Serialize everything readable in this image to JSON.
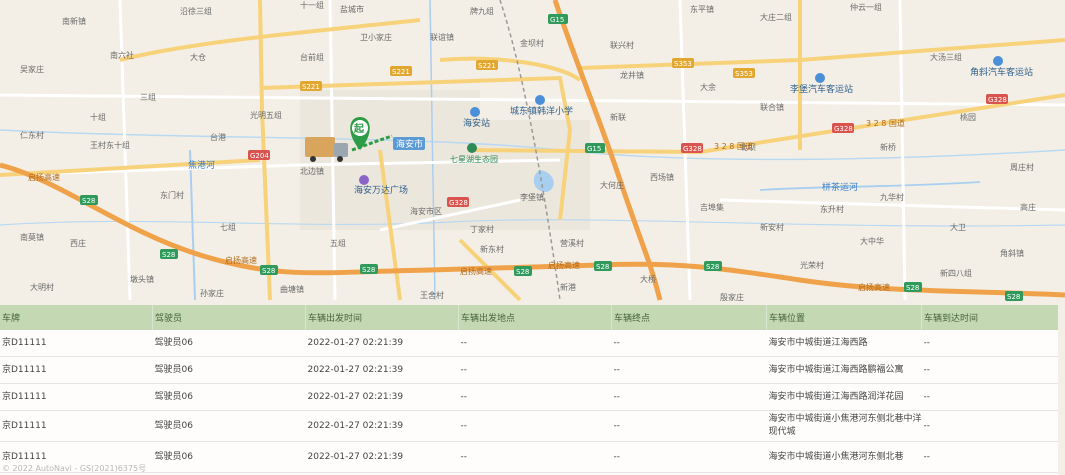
{
  "map": {
    "districts": {
      "haian_city": "海安市",
      "haian_wanda": "海安万达广场",
      "chengdong_school": "城东镇韩洋小学",
      "qixing_park": "七星湖生态园",
      "haian_station": "海安站",
      "lipu_bus": "李堡汽车客运站",
      "jiaoxie_bus": "角斜汽车客运站",
      "rangtong_canal": "栟茶运河",
      "jiaogang_river": "焦港河",
      "start_label": "起"
    },
    "road_labels": {
      "g15_top": "G15",
      "g15_mid": "G15",
      "s221_a": "S221",
      "s221_b": "S221",
      "s221_c": "S221",
      "s353": "S353",
      "s353_b": "S353",
      "g204": "G204",
      "g328_a": "G328",
      "g328_b": "G328",
      "g328_c": "G328",
      "g328_d": "G328",
      "s28_a": "S28",
      "s28_b": "S28",
      "s28_c": "S28",
      "s28_d": "S28",
      "s28_e": "S28",
      "s28_f": "S28",
      "s28_g": "S28",
      "s28_h": "S28",
      "s28_i": "S28",
      "guodao_328": "3 2 8 国道",
      "guodao_328b": "3 2 8 国道",
      "ningyang_a": "启扬高速",
      "ningyang_b": "启扬高速",
      "ningyang_c": "启扬高速",
      "ningyang_d": "启扬高速",
      "ningyang_e": "启扬高速"
    },
    "place_labels": [
      "南新镇",
      "沿徐三组",
      "十一组",
      "盐城市",
      "牌九组",
      "金坝村",
      "联兴村",
      "东平镇",
      "大庄二组",
      "仲云一组",
      "吴家庄",
      "南六社",
      "大仓",
      "台前组",
      "卫小家庄",
      "联谊镇",
      "龙井镇",
      "大余",
      "联合镇",
      "大汤三组",
      "仁东村",
      "王村东十组",
      "东门村",
      "台港",
      "光明五组",
      "北边镇",
      "海安市区",
      "丁家村",
      "李堡镇",
      "大何庄",
      "西场镇",
      "吉埠集",
      "新安村",
      "东升村",
      "九华村",
      "大卫",
      "周庄村",
      "南莫镇",
      "西庄",
      "墩头镇",
      "孙家庄",
      "曲塘镇",
      "王舍村",
      "新东村",
      "营溪村",
      "大桥",
      "殷家庄",
      "光荣村",
      "大中华",
      "新四八组",
      "角斜镇",
      "大明村",
      "十组",
      "三组",
      "七组",
      "五组",
      "新港",
      "新联",
      "北坝",
      "新桥",
      "桃园",
      "高庄"
    ]
  },
  "table": {
    "headers": [
      "车牌",
      "驾驶员",
      "车辆出发时间",
      "车辆出发地点",
      "车辆终点",
      "车辆位置",
      "车辆到达时间"
    ],
    "rows": [
      {
        "plate": "京D11111",
        "driver": "驾驶员06",
        "depart_time": "2022-01-27 02:21:39",
        "depart_place": "--",
        "end_place": "--",
        "location": "海安市中城街道江海西路",
        "arrive_time": "--"
      },
      {
        "plate": "京D11111",
        "driver": "驾驶员06",
        "depart_time": "2022-01-27 02:21:39",
        "depart_place": "--",
        "end_place": "--",
        "location": "海安市中城街道江海西路鹏福公寓",
        "arrive_time": "--"
      },
      {
        "plate": "京D11111",
        "driver": "驾驶员06",
        "depart_time": "2022-01-27 02:21:39",
        "depart_place": "--",
        "end_place": "--",
        "location": "海安市中城街道江海西路润洋花园",
        "arrive_time": "--"
      },
      {
        "plate": "京D11111",
        "driver": "驾驶员06",
        "depart_time": "2022-01-27 02:21:39",
        "depart_place": "--",
        "end_place": "--",
        "location": "海安市中城街道小焦港河东侧北巷中洋 现代城",
        "arrive_time": "--"
      },
      {
        "plate": "京D11111",
        "driver": "驾驶员06",
        "depart_time": "2022-01-27 02:21:39",
        "depart_place": "--",
        "end_place": "--",
        "location": "海安市中城街道小焦港河东侧北巷",
        "arrive_time": "--"
      }
    ],
    "watermark": "© 2022 AutoNavi - GS(2021)6375号"
  },
  "colors": {
    "map_bg": "#f3efe6",
    "expressway": "#f0a24b",
    "highway": "#f7d27a",
    "road": "#ffffff",
    "water": "#a9cff0",
    "table_header": "#c4d9b3",
    "marker_green": "#2e9b46"
  }
}
